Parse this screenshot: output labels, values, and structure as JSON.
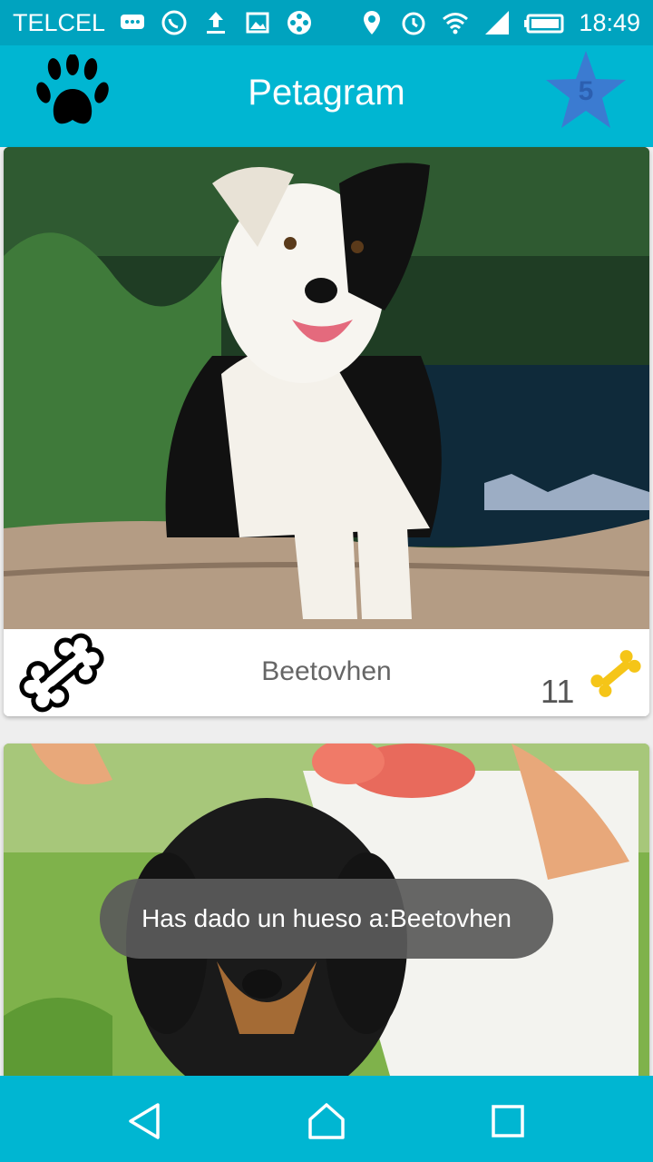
{
  "status_bar": {
    "carrier": "TELCEL",
    "time": "18:49",
    "icons": [
      "message-icon",
      "whatsapp-icon",
      "upload-icon",
      "image-icon",
      "film-icon",
      "location-icon",
      "alarm-icon",
      "wifi-icon",
      "signal-icon",
      "battery-icon"
    ]
  },
  "app_bar": {
    "title": "Petagram",
    "favorites_count": "5",
    "paw_icon": "paw-icon",
    "star_icon": "star-icon"
  },
  "pets": [
    {
      "name": "Beetovhen",
      "likes": "11",
      "photo": "border-collie-photo"
    },
    {
      "name": "",
      "likes": "",
      "photo": "dachshund-photo"
    }
  ],
  "toast": {
    "message": "Has dado un hueso a:Beetovhen"
  },
  "nav_bar": {
    "buttons": [
      "back-icon",
      "home-icon",
      "recent-apps-icon"
    ]
  },
  "colors": {
    "status_bar": "#00a3bf",
    "app_bar": "#00b6d2",
    "star": "#3b7bd1",
    "bone_gold": "#f5c518"
  }
}
